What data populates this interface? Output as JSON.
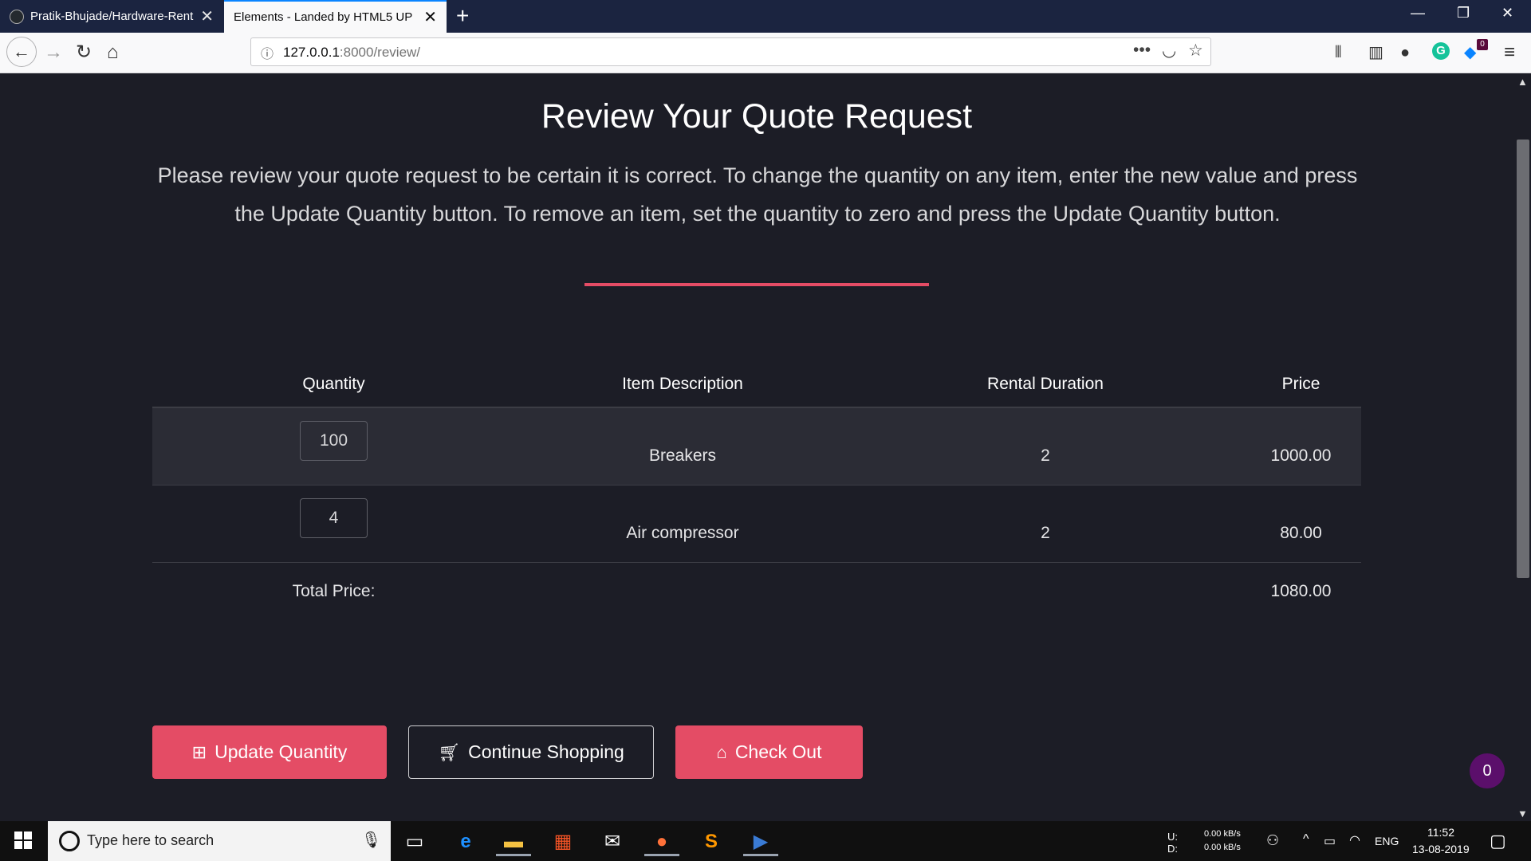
{
  "browser": {
    "tabs": [
      {
        "title": "Pratik-Bhujade/Hardware-Rent",
        "active": false
      },
      {
        "title": "Elements - Landed by HTML5 UP",
        "active": true
      }
    ],
    "url_host": "127.0.0.1",
    "url_path": ":8000/review/",
    "extension_badge": "0",
    "accent_color": "#0a84ff"
  },
  "page": {
    "title": "Review Your Quote Request",
    "intro": "Please review your quote request to be certain it is correct. To change the quantity on any item, enter the new value and press the Update Quantity button. To remove an item, set the quantity to zero and press the Update Quantity button.",
    "accent_color": "#e44c65",
    "table": {
      "headers": [
        "Quantity",
        "Item Description",
        "Rental Duration",
        "Price"
      ],
      "rows": [
        {
          "quantity": "100",
          "description": "Breakers",
          "duration": "2",
          "price": "1000.00"
        },
        {
          "quantity": "4",
          "description": "Air compressor",
          "duration": "2",
          "price": "80.00"
        }
      ],
      "total_label": "Total Price:",
      "total_value": "1080.00"
    },
    "buttons": {
      "update": "Update Quantity",
      "continue": "Continue Shopping",
      "checkout": "Check Out"
    },
    "cart_count": "0"
  },
  "taskbar": {
    "search_placeholder": "Type here to search",
    "net_upload_label": "U:",
    "net_download_label": "D:",
    "net_upload": "0.00 kB/s",
    "net_download": "0.00 kB/s",
    "language": "ENG",
    "time": "11:52",
    "date": "13-08-2019"
  }
}
